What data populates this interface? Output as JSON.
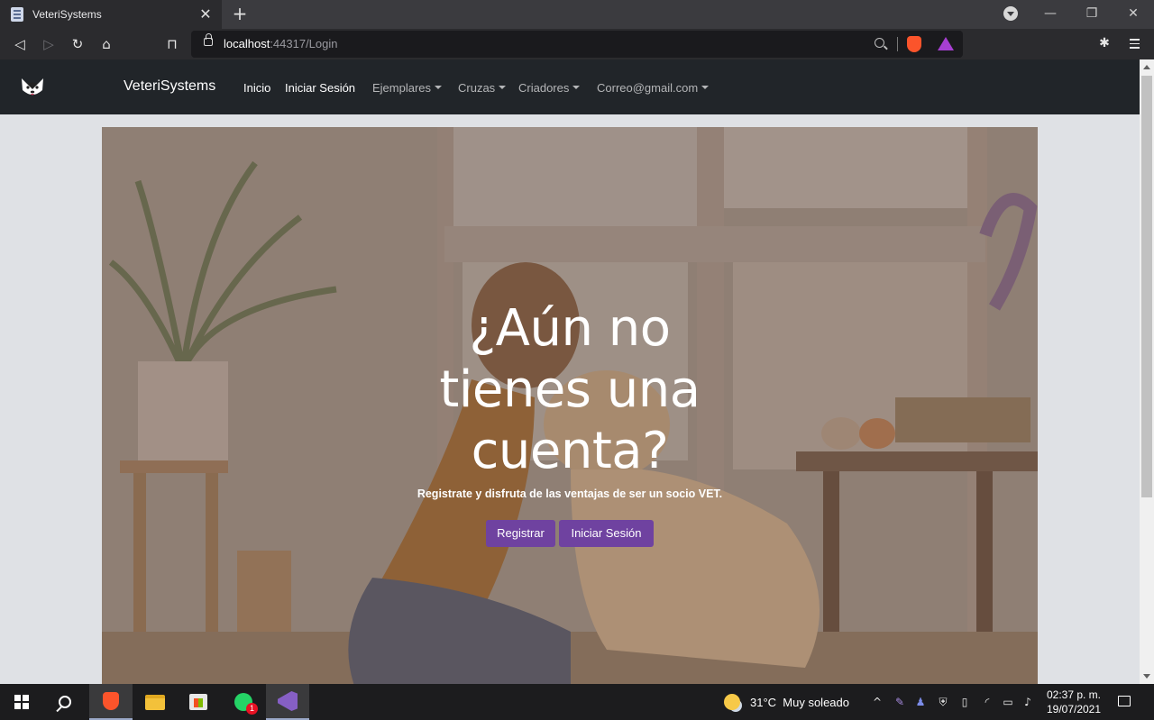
{
  "browser": {
    "tab_title": "VeteriSystems",
    "url_host": "localhost",
    "url_rest": ":44317/Login"
  },
  "navbar": {
    "brand": "VeteriSystems",
    "links": [
      {
        "label": "Inicio",
        "dropdown": false
      },
      {
        "label": "Iniciar Sesión",
        "dropdown": false
      },
      {
        "label": "Ejemplares",
        "dropdown": true
      },
      {
        "label": "Cruzas",
        "dropdown": true
      },
      {
        "label": "Criadores",
        "dropdown": true
      },
      {
        "label": "Correo@gmail.com",
        "dropdown": true
      }
    ]
  },
  "hero": {
    "title": "¿Aún no tienes una cuenta?",
    "subtitle": "Registrate y disfruta de las ventajas de ser un socio VET.",
    "register_label": "Registrar",
    "login_label": "Iniciar Sesión"
  },
  "taskbar": {
    "weather_temp": "31°C",
    "weather_desc": "Muy soleado",
    "time": "02:37 p. m.",
    "date": "19/07/2021",
    "whatsapp_badge": "1"
  },
  "colors": {
    "navbar_bg": "#212529",
    "button_bg": "#6f42a0",
    "page_bg": "#dfe1e5"
  }
}
